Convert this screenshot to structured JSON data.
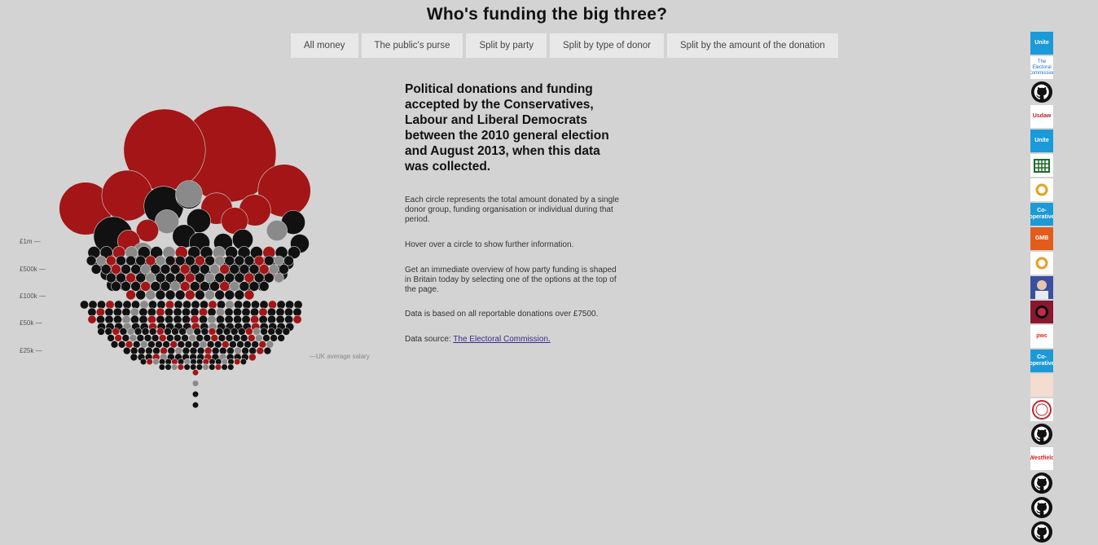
{
  "page": {
    "title": "Who's funding the big three?"
  },
  "nav": {
    "items": [
      {
        "label": "All money"
      },
      {
        "label": "The public's purse"
      },
      {
        "label": "Split by party"
      },
      {
        "label": "Split by type of donor"
      },
      {
        "label": "Split by the amount of the donation"
      }
    ]
  },
  "scale": {
    "ticks": [
      "£1m —",
      "£500k —",
      "£100k —",
      "£50k —",
      "£25k —"
    ],
    "salary_label": "—UK average salary"
  },
  "info": {
    "heading": "Political donations and funding accepted by the Conservatives, Labour and Liberal Democrats between the 2010 general election and August 2013, when this data was collected.",
    "p1": "Each circle represents the total amount donated by a single donor group, funding organisation or individual during that period.",
    "p2": "Hover over a circle to show further information.",
    "p3": "Get an immediate overview of how party funding is shaped in Britain today by selecting one of the options at the top of the page.",
    "p4": "Data is based on all reportable donations over £7500.",
    "source_prefix": "Data source: ",
    "source_link": "The Electoral Commission."
  },
  "logos": [
    {
      "name": "unite-logo",
      "text": "Unite",
      "color": "#1a9ad9"
    },
    {
      "name": "electoral-commission-logo",
      "text": "The Electoral Commission",
      "color": "#1a6fc2"
    },
    {
      "name": "github-icon",
      "text": "",
      "color": "#111111"
    },
    {
      "name": "usdaw-logo",
      "text": "Usdaw",
      "color": "#b21e2e"
    },
    {
      "name": "unite-logo",
      "text": "Unite",
      "color": "#1a9ad9"
    },
    {
      "name": "parliament-portcullis-logo",
      "text": "",
      "color": "#1d6b2a"
    },
    {
      "name": "ring-logo",
      "text": "",
      "color": "#e8a020"
    },
    {
      "name": "cooperative-logo",
      "text": "Co-operative",
      "color": "#1c9ad6"
    },
    {
      "name": "gmb-logo",
      "text": "GMB",
      "color": "#e25c1c"
    },
    {
      "name": "ring-logo",
      "text": "",
      "color": "#e8a020"
    },
    {
      "name": "portrait-photo",
      "text": "",
      "color": "#3a4fa0"
    },
    {
      "name": "crest-logo",
      "text": "",
      "color": "#8a1730"
    },
    {
      "name": "pwc-logo",
      "text": "pwc",
      "color": "#e0301e"
    },
    {
      "name": "cooperative-logo",
      "text": "Co-operative",
      "color": "#1c9ad6"
    },
    {
      "name": "faint-logo",
      "text": "",
      "color": "#e5a27a"
    },
    {
      "name": "seal-logo",
      "text": "",
      "color": "#c0262d"
    },
    {
      "name": "github-icon",
      "text": "",
      "color": "#111111"
    },
    {
      "name": "westfield-logo",
      "text": "Westfield",
      "color": "#d11f26"
    },
    {
      "name": "github-icon",
      "text": "",
      "color": "#111111"
    },
    {
      "name": "github-icon",
      "text": "",
      "color": "#111111"
    },
    {
      "name": "github-icon",
      "text": "",
      "color": "#111111"
    }
  ],
  "colors": {
    "background": "#d3d3d3",
    "conservative": "#111111",
    "labour": "#a31516",
    "libdem": "#8a8a8a",
    "link": "#3a2a8c"
  },
  "chart_data": {
    "type": "scatter",
    "encoding": "packed bubble chart, circle area proportional to total donated per donor",
    "scale_ticks_gbp": [
      1000000,
      500000,
      100000,
      50000,
      25000
    ],
    "reference_line": {
      "label": "—UK average salary",
      "value_gbp": 25000
    },
    "series": [
      {
        "color": "#111111"
      },
      {
        "color": "#a31516"
      },
      {
        "color": "#8a8a8a"
      }
    ],
    "large_donors_gbp_est": [
      {
        "color": "#a31516",
        "amount": 6500000
      },
      {
        "color": "#a31516",
        "amount": 4700000
      },
      {
        "color": "#a31516",
        "amount": 1950000
      },
      {
        "color": "#a31516",
        "amount": 1950000
      },
      {
        "color": "#a31516",
        "amount": 1800000
      },
      {
        "color": "#111111",
        "amount": 1100000
      },
      {
        "color": "#111111",
        "amount": 1080000
      },
      {
        "color": "#a31516",
        "amount": 700000
      },
      {
        "color": "#a31516",
        "amount": 700000
      },
      {
        "color": "#111111",
        "amount": 500000
      },
      {
        "color": "#8a8a8a",
        "amount": 500000
      },
      {
        "color": "#a31516",
        "amount": 500000
      },
      {
        "color": "#111111",
        "amount": 400000
      },
      {
        "color": "#8a8a8a",
        "amount": 400000
      },
      {
        "color": "#111111",
        "amount": 400000
      },
      {
        "color": "#111111",
        "amount": 380000
      },
      {
        "color": "#a31516",
        "amount": 350000
      },
      {
        "color": "#a31516",
        "amount": 350000
      },
      {
        "color": "#111111",
        "amount": 300000
      },
      {
        "color": "#111111",
        "amount": 300000
      },
      {
        "color": "#8a8a8a",
        "amount": 300000
      },
      {
        "color": "#8a8a8a",
        "amount": 280000
      },
      {
        "color": "#111111",
        "amount": 250000
      },
      {
        "color": "#111111",
        "amount": 250000
      }
    ],
    "bands": [
      {
        "label": "£1m —",
        "colors": [
          "#111111",
          "#111111",
          "#a31516",
          "#8a8a8a",
          "#111111",
          "#111111",
          "#8a8a8a",
          "#a31516",
          "#111111",
          "#111111",
          "#8a8a8a",
          "#111111",
          "#111111",
          "#111111",
          "#a31516",
          "#111111"
        ]
      },
      {
        "label": "£500k —",
        "colors": [
          "#111111",
          "#8a8a8a",
          "#a31516",
          "#111111",
          "#111111",
          "#111111",
          "#a31516",
          "#8a8a8a",
          "#111111",
          "#111111",
          "#111111",
          "#a31516",
          "#111111",
          "#8a8a8a",
          "#111111",
          "#111111",
          "#111111",
          "#a31516",
          "#111111",
          "#8a8a8a",
          "#111111",
          "#111111",
          "#111111",
          "#a31516",
          "#111111",
          "#111111",
          "#8a8a8a",
          "#111111",
          "#111111",
          "#111111",
          "#a31516",
          "#111111"
        ]
      },
      {
        "label": "£100k —",
        "colors": [
          "#111111",
          "#111111",
          "#111111",
          "#a31516",
          "#111111",
          "#111111",
          "#111111",
          "#8a8a8a",
          "#111111",
          "#111111",
          "#a31516",
          "#111111",
          "#111111",
          "#111111",
          "#111111",
          "#a31516",
          "#111111",
          "#8a8a8a",
          "#111111",
          "#111111",
          "#111111",
          "#111111",
          "#a31516",
          "#111111"
        ]
      },
      {
        "label": "£50k —",
        "colors": [
          "#111111",
          "#111111",
          "#a31516",
          "#111111",
          "#8a8a8a",
          "#111111",
          "#111111",
          "#111111",
          "#a31516",
          "#111111",
          "#111111",
          "#111111",
          "#8a8a8a",
          "#111111",
          "#111111",
          "#a31516",
          "#111111",
          "#111111",
          "#111111",
          "#111111",
          "#a31516",
          "#8a8a8a",
          "#111111",
          "#111111",
          "#111111"
        ]
      },
      {
        "label": "£25k —",
        "colors": [
          "#111111",
          "#a31516",
          "#8a8a8a",
          "#111111",
          "#111111",
          "#a31516",
          "#111111",
          "#8a8a8a",
          "#111111",
          "#111111",
          "#a31516",
          "#111111",
          "#111111",
          "#8a8a8a",
          "#111111",
          "#a31516",
          "#111111",
          "#111111",
          "#111111",
          "#8a8a8a",
          "#a31516",
          "#111111",
          "#111111",
          "#111111",
          "#8a8a8a",
          "#111111",
          "#a31516",
          "#111111"
        ]
      }
    ]
  }
}
